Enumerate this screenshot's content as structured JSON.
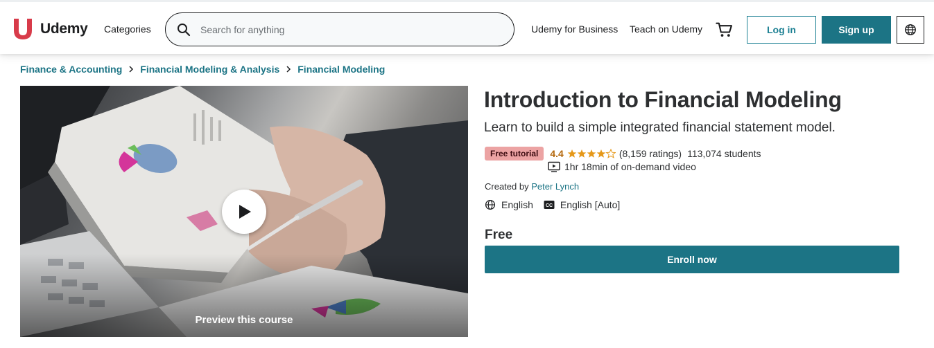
{
  "header": {
    "logo_text": "Udemy",
    "categories_label": "Categories",
    "search_placeholder": "Search for anything",
    "business_label": "Udemy for Business",
    "teach_label": "Teach on Udemy",
    "login_label": "Log in",
    "signup_label": "Sign up"
  },
  "breadcrumb": [
    "Finance & Accounting",
    "Financial Modeling & Analysis",
    "Financial Modeling"
  ],
  "preview": {
    "label": "Preview this course"
  },
  "course": {
    "title": "Introduction to Financial Modeling",
    "subtitle": "Learn to build a simple integrated financial statement model.",
    "badge": "Free tutorial",
    "rating": "4.4",
    "rating_value": 4.4,
    "rating_count": "(8,159 ratings)",
    "students": "113,074 students",
    "video_length": "1hr 18min of on-demand video",
    "created_by_label": "Created by",
    "instructor": "Peter Lynch",
    "language": "English",
    "captions": "English [Auto]",
    "price": "Free",
    "enroll_label": "Enroll now"
  },
  "colors": {
    "accent": "#1c7485",
    "rating": "#e59819",
    "badge_bg": "#eca3a3"
  }
}
